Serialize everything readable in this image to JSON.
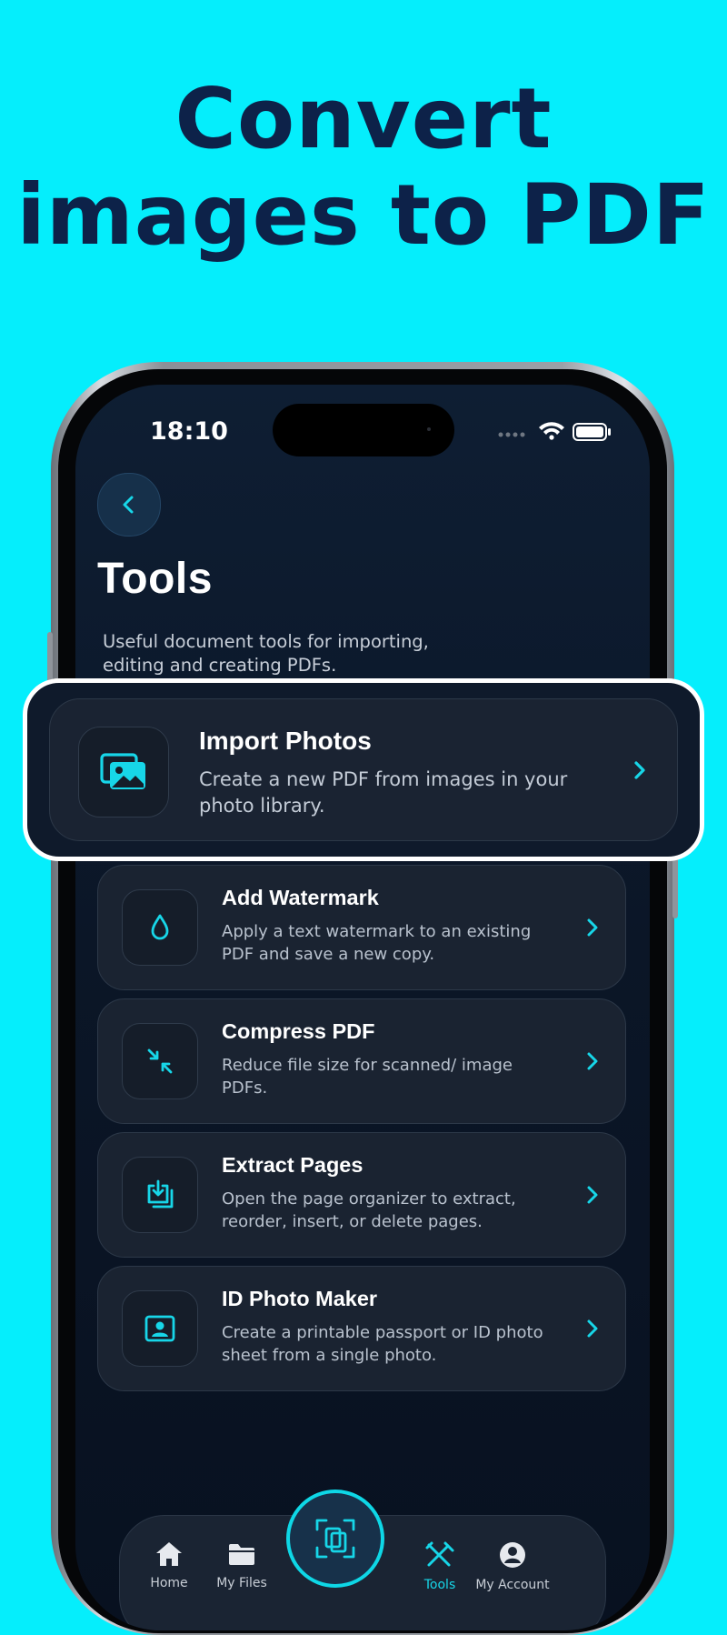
{
  "headline": {
    "line1": "Convert",
    "line2": "images to PDF"
  },
  "status": {
    "time": "18:10"
  },
  "page": {
    "title": "Tools",
    "subtitle": "Useful document tools for importing, editing and creating PDFs."
  },
  "highlight_card": {
    "title": "Import Photos",
    "desc": "Create a new PDF from images in your photo library.",
    "icon": "photos-icon"
  },
  "tools": [
    {
      "title": "Add Watermark",
      "desc": "Apply a text watermark to an existing PDF and save a new copy.",
      "icon": "droplet-icon"
    },
    {
      "title": "Compress PDF",
      "desc": "Reduce file size for scanned/ image PDFs.",
      "icon": "compress-arrows-icon"
    },
    {
      "title": "Extract Pages",
      "desc": "Open the page organizer to extract, reorder, insert, or delete pages.",
      "icon": "extract-tray-icon"
    },
    {
      "title": "ID Photo Maker",
      "desc": "Create a printable passport or ID photo sheet from a single photo.",
      "icon": "id-photo-icon"
    }
  ],
  "tabbar": {
    "items": [
      {
        "label": "Home",
        "icon": "home-icon"
      },
      {
        "label": "My Files",
        "icon": "folder-icon"
      },
      {
        "label": "Tools",
        "icon": "tools-icon",
        "active": true
      },
      {
        "label": "My Account",
        "icon": "account-icon"
      }
    ],
    "center_icon": "scan-icon"
  },
  "colors": {
    "background": "#05eefc",
    "headline": "#0d2249",
    "accent": "#17d6e8",
    "screen": "#0b1627"
  }
}
